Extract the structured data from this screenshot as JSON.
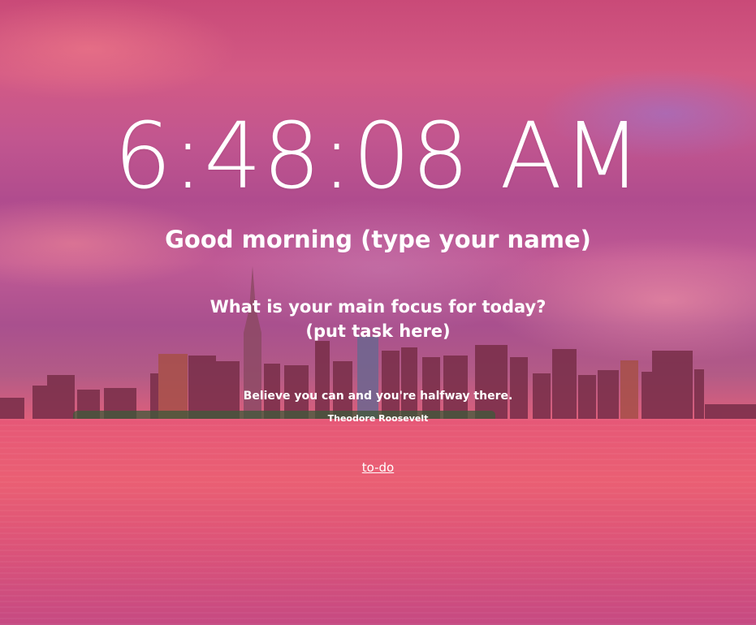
{
  "clock": {
    "time": "6:48:08 AM"
  },
  "greeting": {
    "text": "Good morning (type your name)"
  },
  "focus": {
    "question": "What is your main focus for today?",
    "task": "(put task here)"
  },
  "quote": {
    "text": "Believe you can and you're halfway there.",
    "author": "Theodore Roosevelt"
  },
  "links": {
    "todo": "to-do"
  },
  "background": {
    "scene": "city-skyline-at-sunset",
    "colors": {
      "sky": "#c2568f",
      "water": "#e65877",
      "buildings": "#7a2f4a"
    }
  }
}
